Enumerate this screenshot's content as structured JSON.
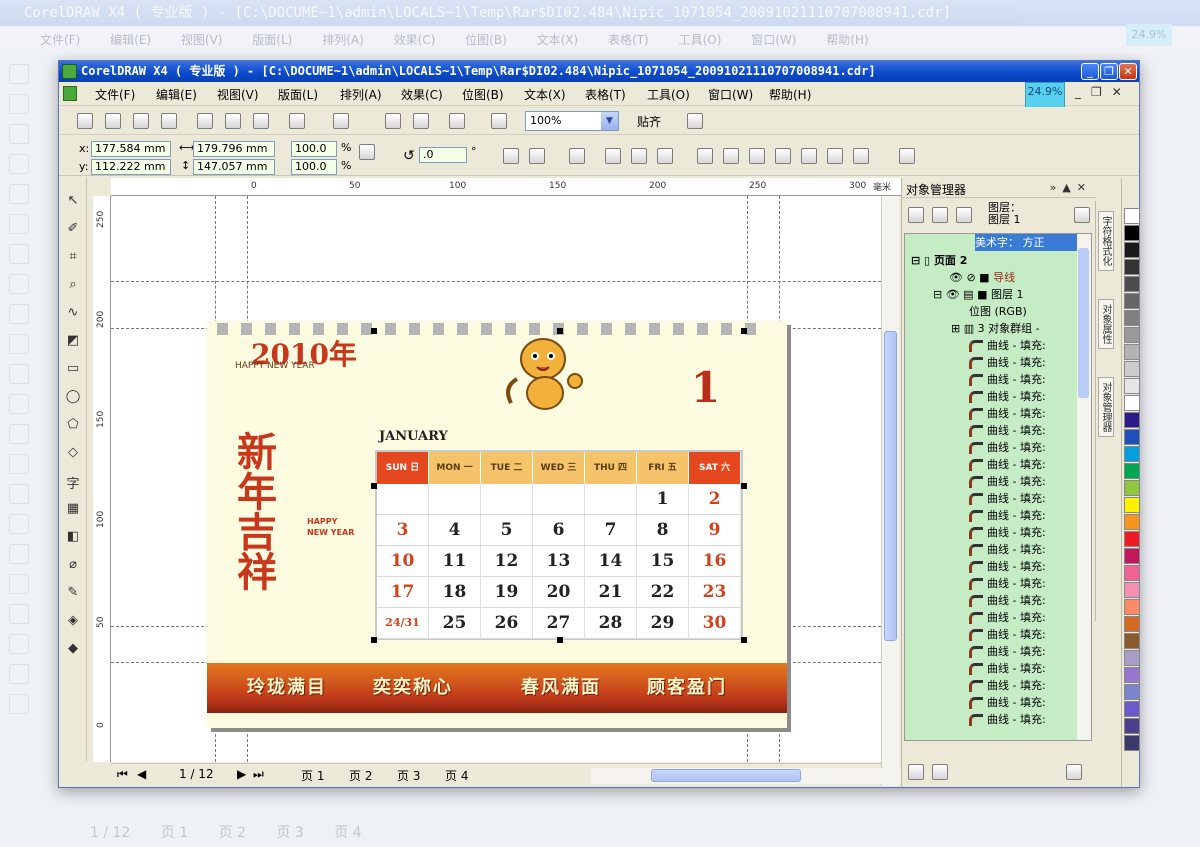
{
  "background_window": {
    "title": "CorelDRAW X4 ( 专业版 ) - [C:\\DOCUME~1\\admin\\LOCALS~1\\Temp\\Rar$DI02.484\\Nipic_1071054_20091021110707008941.cdr]",
    "menu": [
      "文件(F)",
      "编辑(E)",
      "视图(V)",
      "版面(L)",
      "排列(A)",
      "效果(C)",
      "位图(B)",
      "文本(X)",
      "表格(T)",
      "工具(O)",
      "窗口(W)",
      "帮助(H)"
    ],
    "zoom": "24.9%",
    "page_counter": "1 / 12",
    "page_tabs": [
      "页 1",
      "页 2",
      "页 3",
      "页 4"
    ]
  },
  "window": {
    "title": "CorelDRAW X4 ( 专业版 ) - [C:\\DOCUME~1\\admin\\LOCALS~1\\Temp\\Rar$DI02.484\\Nipic_1071054_20091021110707008941.cdr]",
    "zoom_indicator": "24.9%"
  },
  "menu": [
    "文件(F)",
    "编辑(E)",
    "视图(V)",
    "版面(L)",
    "排列(A)",
    "效果(C)",
    "位图(B)",
    "文本(X)",
    "表格(T)",
    "工具(O)",
    "窗口(W)",
    "帮助(H)"
  ],
  "toolbar": {
    "zoom_value": "100%",
    "snap_label": "贴齐"
  },
  "property_bar": {
    "x_label": "x:",
    "x_value": "177.584 mm",
    "y_label": "y:",
    "y_value": "112.222 mm",
    "width_value": "179.796 mm",
    "height_value": "147.057 mm",
    "scale_x": "100.0",
    "scale_y": "100.0",
    "percent": "%",
    "rotation": ".0",
    "degree": "°"
  },
  "ruler": {
    "h_ticks": [
      "0",
      "50",
      "100",
      "150",
      "200",
      "250",
      "300"
    ],
    "v_ticks": [
      "250",
      "200",
      "150",
      "100",
      "50",
      "0"
    ],
    "unit": "毫米"
  },
  "calendar": {
    "year_text": "2010年",
    "happy_new_year": "HAPPY NEW YEAR",
    "month_number": "1",
    "side_text": "新年吉祥",
    "side_happy": "HAPPY NEW YEAR",
    "month_label": "JANUARY",
    "weekdays": [
      "SUN 日",
      "MON 一",
      "TUE 二",
      "WED 三",
      "THU 四",
      "FRI 五",
      "SAT 六"
    ],
    "rows": [
      [
        "",
        "",
        "",
        "",
        "",
        "1",
        "2"
      ],
      [
        "3",
        "4",
        "5",
        "6",
        "7",
        "8",
        "9"
      ],
      [
        "10",
        "11",
        "12",
        "13",
        "14",
        "15",
        "16"
      ],
      [
        "17",
        "18",
        "19",
        "20",
        "21",
        "22",
        "23"
      ],
      [
        "24/31",
        "25",
        "26",
        "27",
        "28",
        "29",
        "30"
      ]
    ],
    "banner": [
      "玲珑满目",
      "奕奕称心",
      "春风满面",
      "顾客盈门"
    ]
  },
  "page_nav": {
    "counter": "1 / 12",
    "tabs": [
      "页 1",
      "页 2",
      "页 3",
      "页 4"
    ]
  },
  "object_manager": {
    "title": "对象管理器",
    "layer_header_1": "图层：",
    "layer_header_2": "图层 1",
    "art_text": "美术字： 方正",
    "page": "页面 2",
    "guides": "导线",
    "layer": "图层 1",
    "bitmap": "位图 (RGB)",
    "group": "3 对象群组 -",
    "curve_label": "曲线 - 填充:",
    "curve_count": 23
  },
  "side_tabs": [
    "字符格式化",
    "对象属性",
    "对象管理器"
  ],
  "palette_colors": [
    "#ffffff",
    "#000000",
    "#1a1a1a",
    "#333333",
    "#4d4d4d",
    "#666666",
    "#808080",
    "#999999",
    "#b3b3b3",
    "#cccccc",
    "#e6e6e6",
    "#ffffff",
    "#2e1a87",
    "#1f52b8",
    "#00a0e0",
    "#00a651",
    "#8dc63f",
    "#fff200",
    "#f7941d",
    "#ed1c24",
    "#c2185b",
    "#f06292",
    "#f48fb1",
    "#ff8a65",
    "#d2691e",
    "#8b5a2b",
    "#a89cc8",
    "#9575cd",
    "#7986cb",
    "#6a5acd",
    "#4b3f8a",
    "#3a3a6a"
  ]
}
